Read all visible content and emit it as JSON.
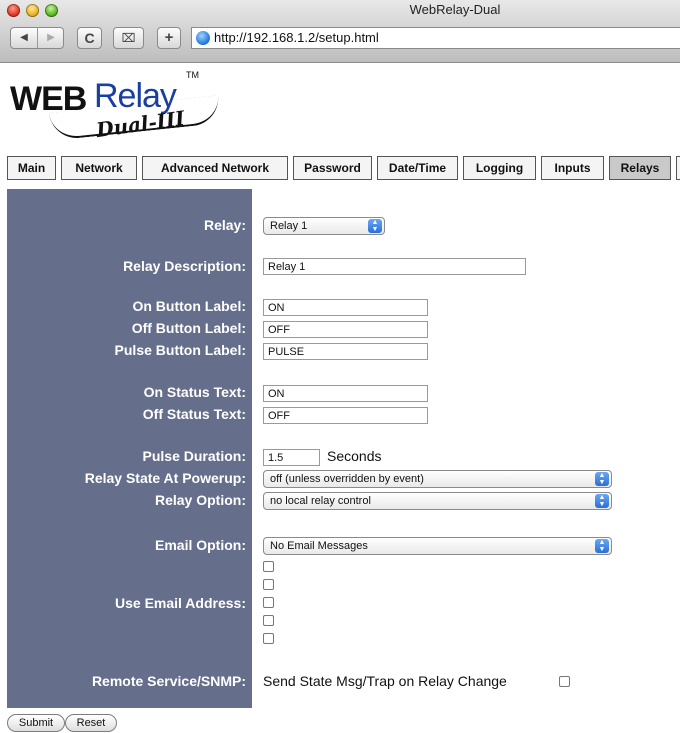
{
  "window": {
    "title": "WebRelay-Dual"
  },
  "browser": {
    "back_glyph": "◀",
    "forward_glyph": "▶",
    "reload_glyph": "C",
    "snapback_glyph": "⌧",
    "add_glyph": "+",
    "url": "http://192.168.1.2/setup.html"
  },
  "logo": {
    "web": "WEB",
    "relay": "Relay",
    "tm": "TM",
    "sub": "Dual-III"
  },
  "tabs": [
    "Main",
    "Network",
    "Advanced Network",
    "Password",
    "Date/Time",
    "Logging",
    "Inputs",
    "Relays"
  ],
  "active_tab": "Relays",
  "form": {
    "relay_label": "Relay:",
    "relay_value": "Relay 1",
    "description_label": "Relay Description:",
    "description_value": "Relay 1",
    "on_button_label": "On Button Label:",
    "on_button_value": "ON",
    "off_button_label": "Off Button Label:",
    "off_button_value": "OFF",
    "pulse_button_label": "Pulse Button Label:",
    "pulse_button_value": "PULSE",
    "on_status_label": "On Status Text:",
    "on_status_value": "ON",
    "off_status_label": "Off Status Text:",
    "off_status_value": "OFF",
    "pulse_duration_label": "Pulse Duration:",
    "pulse_duration_value": "1.5",
    "pulse_duration_unit": "Seconds",
    "powerup_label": "Relay State At Powerup:",
    "powerup_value": "off (unless overridden by event)",
    "relay_option_label": "Relay Option:",
    "relay_option_value": "no local relay control",
    "email_option_label": "Email Option:",
    "email_option_value": "No Email Messages",
    "use_email_label": "Use Email Address:",
    "email_checkbox_count": 5,
    "remote_label": "Remote Service/SNMP:",
    "remote_text": "Send State Msg/Trap on Relay Change"
  },
  "buttons": {
    "submit": "Submit",
    "reset": "Reset"
  }
}
